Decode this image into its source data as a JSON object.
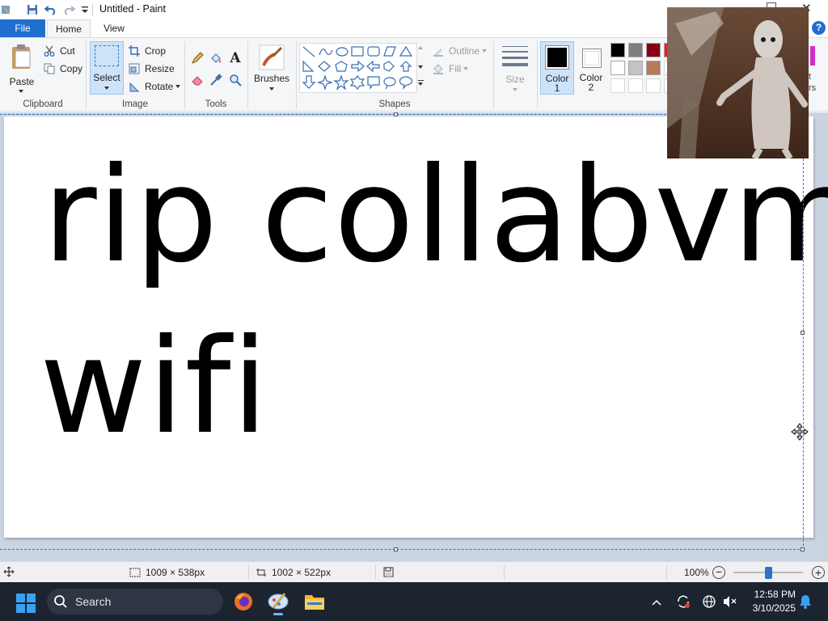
{
  "window": {
    "title": "Untitled - Paint",
    "close_glyph": "✕"
  },
  "tabs": [
    {
      "label": "File"
    },
    {
      "label": "Home"
    },
    {
      "label": "View"
    }
  ],
  "ribbon": {
    "clipboard": {
      "paste_label": "Paste",
      "cut_label": "Cut",
      "copy_label": "Copy",
      "group_label": "Clipboard"
    },
    "image": {
      "select_label": "Select",
      "crop_label": "Crop",
      "resize_label": "Resize",
      "rotate_label": "Rotate",
      "group_label": "Image"
    },
    "tools": {
      "group_label": "Tools",
      "icons": [
        "pencil-icon",
        "fill-bucket-icon",
        "text-icon",
        "eraser-icon",
        "color-picker-icon",
        "magnifier-icon"
      ]
    },
    "brushes": {
      "label": "Brushes"
    },
    "shapes": {
      "group_label": "Shapes",
      "outline_label": "Outline",
      "fill_label": "Fill"
    },
    "size": {
      "label": "Size"
    },
    "colors": {
      "color1_label": "Color",
      "color1_num": "1",
      "color2_label": "Color",
      "color2_num": "2",
      "color1_value": "#000000",
      "color2_value": "#ffffff",
      "palette_row1": [
        "#000000",
        "#7f7f7f",
        "#880015",
        "#ed1c24"
      ],
      "palette_row2": [
        "#ffffff",
        "#c3c3c3",
        "#b97a57"
      ],
      "partial_label_rs": "rs",
      "partial_label_t": "t",
      "accent_magenta": "#d22ecf"
    },
    "help_glyph": "?"
  },
  "canvas": {
    "line1": "rip collabvm",
    "line2": "wifi"
  },
  "statusbar": {
    "selection_size": "1009 × 538px",
    "canvas_size": "1002 × 522px",
    "zoom": "100%",
    "zoom_minus": "−",
    "zoom_plus": "+"
  },
  "taskbar": {
    "search_placeholder": "Search",
    "time": "12:58 PM",
    "date": "3/10/2025"
  }
}
